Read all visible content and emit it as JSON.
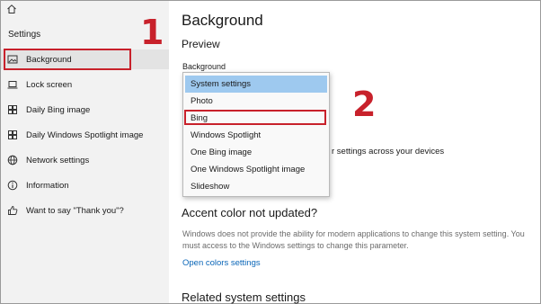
{
  "sidebar": {
    "title": "Settings",
    "items": [
      {
        "label": "Background",
        "icon": "image-icon"
      },
      {
        "label": "Lock screen",
        "icon": "laptop-icon"
      },
      {
        "label": "Daily Bing image",
        "icon": "grid-icon"
      },
      {
        "label": "Daily Windows Spotlight image",
        "icon": "grid-icon"
      },
      {
        "label": "Network settings",
        "icon": "globe-icon"
      },
      {
        "label": "Information",
        "icon": "info-icon"
      },
      {
        "label": "Want to say \"Thank you\"?",
        "icon": "like-icon"
      }
    ]
  },
  "annotations": {
    "step1": "1",
    "step2": "2",
    "color": "#c8212b"
  },
  "main": {
    "title": "Background",
    "preview_heading": "Preview",
    "background_label": "Background",
    "partial_text": "r settings across your devices",
    "accent_heading": "Accent color not updated?",
    "accent_description": "Windows does not provide the ability for modern applications to change this system setting. You must access to the Windows settings to change this parameter.",
    "colors_link": "Open colors settings",
    "related_heading": "Related system settings"
  },
  "dropdown": {
    "options": [
      "System settings",
      "Photo",
      "Bing",
      "Windows Spotlight",
      "One Bing image",
      "One Windows Spotlight image",
      "Slideshow"
    ],
    "selected_index": 0,
    "highlighted_option": "Bing"
  },
  "colors": {
    "accent_link": "#0a66b8",
    "selected_bg": "#9ec9ef",
    "sidebar_bg": "#f2f2f2"
  }
}
